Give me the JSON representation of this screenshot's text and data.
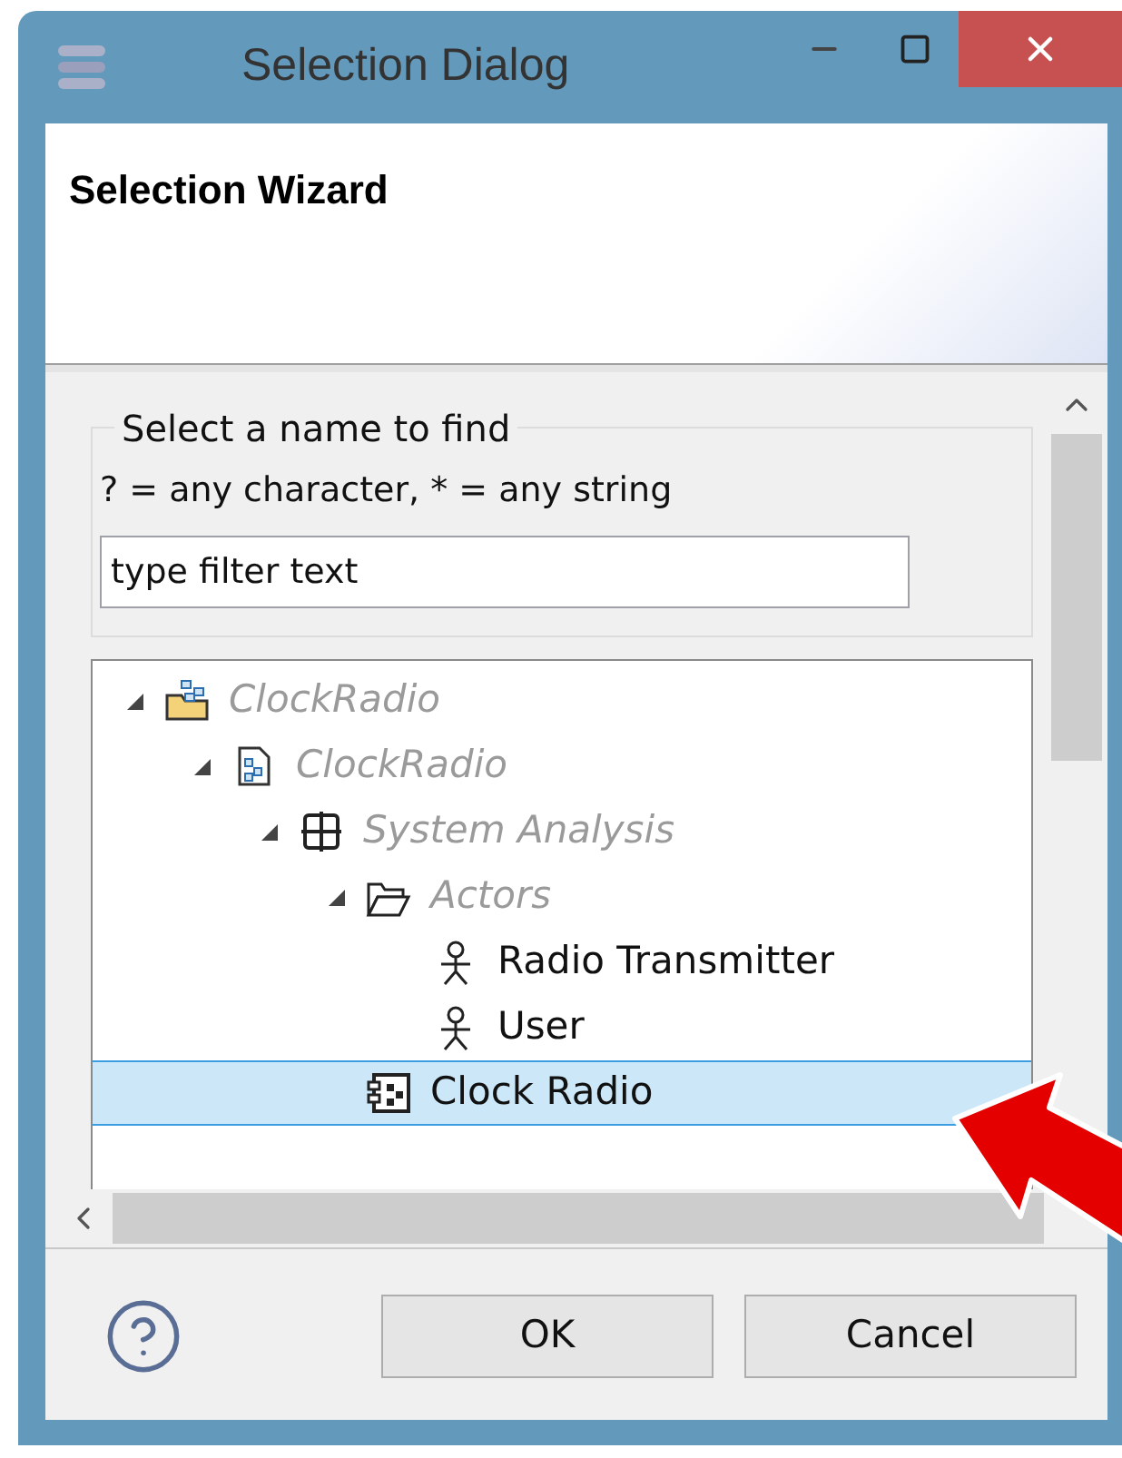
{
  "window": {
    "title": "Selection Dialog"
  },
  "wizard": {
    "title": "Selection Wizard"
  },
  "filter": {
    "legend": "Select a name to find",
    "hint": "? = any character, * = any string",
    "value": "type filter text"
  },
  "tree": [
    {
      "kind": "project",
      "label": "ClockRadio",
      "greyed": true,
      "selected": false,
      "expanded": true,
      "children": [
        {
          "kind": "model",
          "label": "ClockRadio",
          "greyed": true,
          "selected": false,
          "expanded": true,
          "children": [
            {
              "kind": "package",
              "label": "System Analysis",
              "greyed": true,
              "selected": false,
              "expanded": true,
              "children": [
                {
                  "kind": "folder",
                  "label": "Actors",
                  "greyed": true,
                  "selected": false,
                  "expanded": true,
                  "children": [
                    {
                      "kind": "actor",
                      "label": "Radio Transmitter",
                      "greyed": false,
                      "selected": false
                    },
                    {
                      "kind": "actor",
                      "label": "User",
                      "greyed": false,
                      "selected": false
                    }
                  ]
                },
                {
                  "kind": "block",
                  "label": "Clock Radio",
                  "greyed": false,
                  "selected": true
                }
              ]
            }
          ]
        }
      ]
    }
  ],
  "buttons": [
    {
      "label": "OK"
    },
    {
      "label": "Cancel"
    }
  ]
}
